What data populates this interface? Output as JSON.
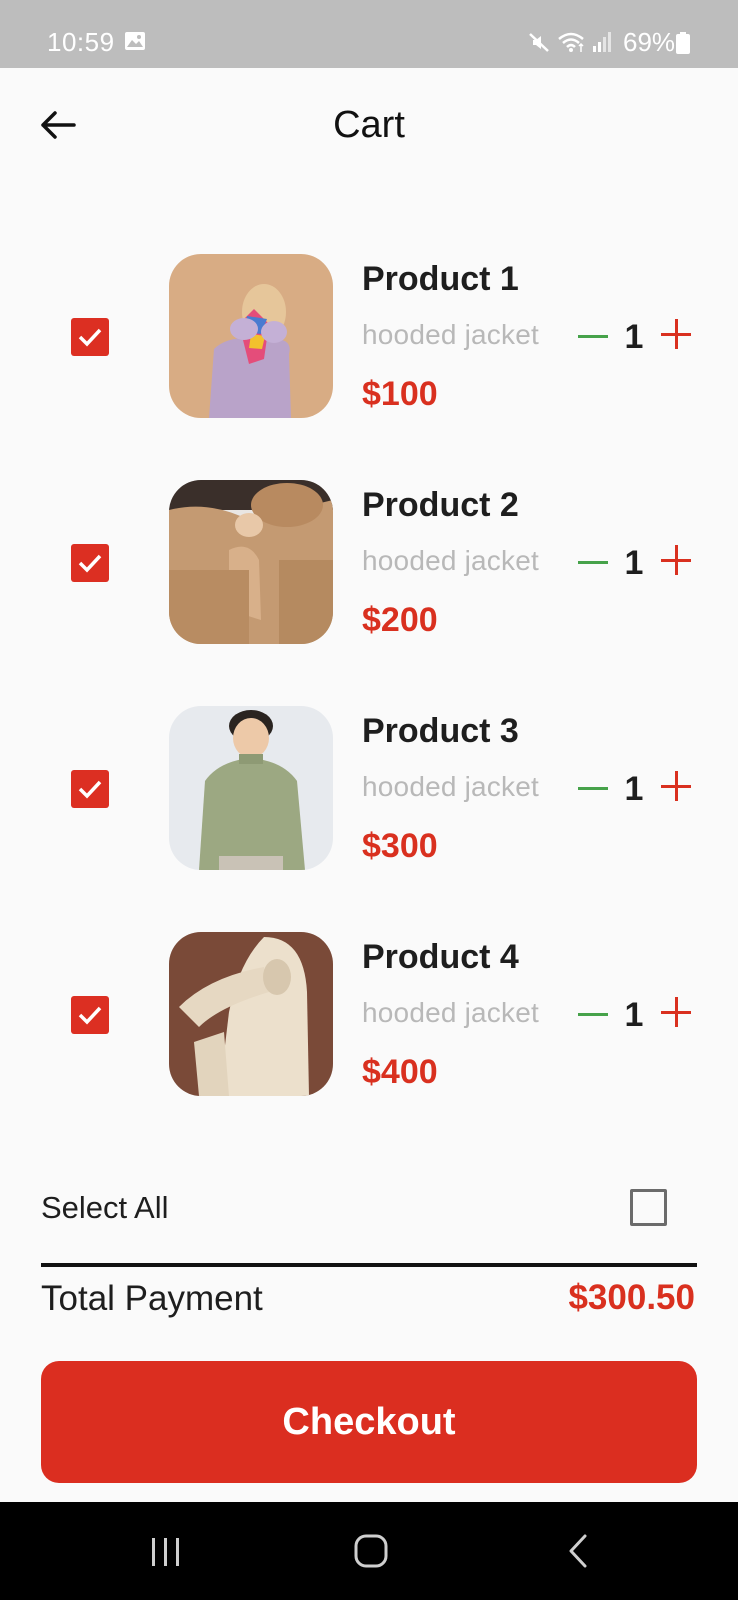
{
  "status_bar": {
    "time": "10:59",
    "battery": "69%",
    "icons": [
      "gallery-icon",
      "mute-icon",
      "wifi-icon",
      "signal-icon",
      "battery-icon"
    ]
  },
  "header": {
    "title": "Cart",
    "back_icon": "arrow-left-icon"
  },
  "cart": {
    "items": [
      {
        "name": "Product 1",
        "description": "hooded jacket",
        "price": "$100",
        "quantity": "1",
        "checked": true,
        "image": "girl in lilac sweater with rainbow scarf"
      },
      {
        "name": "Product 2",
        "description": "hooded jacket",
        "price": "$200",
        "quantity": "1",
        "checked": true,
        "image": "beige knit turtleneck sweater"
      },
      {
        "name": "Product 3",
        "description": "hooded jacket",
        "price": "$300",
        "quantity": "1",
        "checked": true,
        "image": "boy in olive knit sweater"
      },
      {
        "name": "Product 4",
        "description": "hooded jacket",
        "price": "$400",
        "quantity": "1",
        "checked": true,
        "image": "child in cream hoodie"
      }
    ]
  },
  "select_all": {
    "label": "Select All",
    "checked": false
  },
  "total": {
    "label": "Total Payment",
    "value": "$300.50"
  },
  "checkout": {
    "label": "Checkout"
  },
  "nav_bar": {
    "icons": [
      "recent-apps-icon",
      "home-icon",
      "back-icon"
    ]
  },
  "colors": {
    "accent": "#dc2f22",
    "minus": "#46a24a",
    "status_bar": "#bdbdbd",
    "muted_text": "#b8b8b8"
  }
}
